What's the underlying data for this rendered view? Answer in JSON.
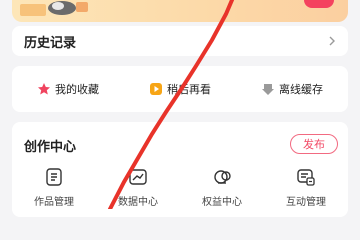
{
  "history": {
    "title": "历史记录"
  },
  "quick_actions": [
    {
      "label": "我的收藏",
      "icon": "star-icon"
    },
    {
      "label": "稍后再看",
      "icon": "play-later-icon"
    },
    {
      "label": "离线缓存",
      "icon": "download-icon"
    }
  ],
  "creation_center": {
    "title": "创作中心",
    "publish_label": "发布",
    "tools": [
      {
        "label": "作品管理",
        "icon": "works-icon"
      },
      {
        "label": "数据中心",
        "icon": "chart-icon"
      },
      {
        "label": "权益中心",
        "icon": "benefits-icon"
      },
      {
        "label": "互动管理",
        "icon": "interaction-icon"
      }
    ]
  },
  "colors": {
    "accent": "#f24a66",
    "annotation_stroke": "#e8332a",
    "background": "#f4f4f6"
  }
}
